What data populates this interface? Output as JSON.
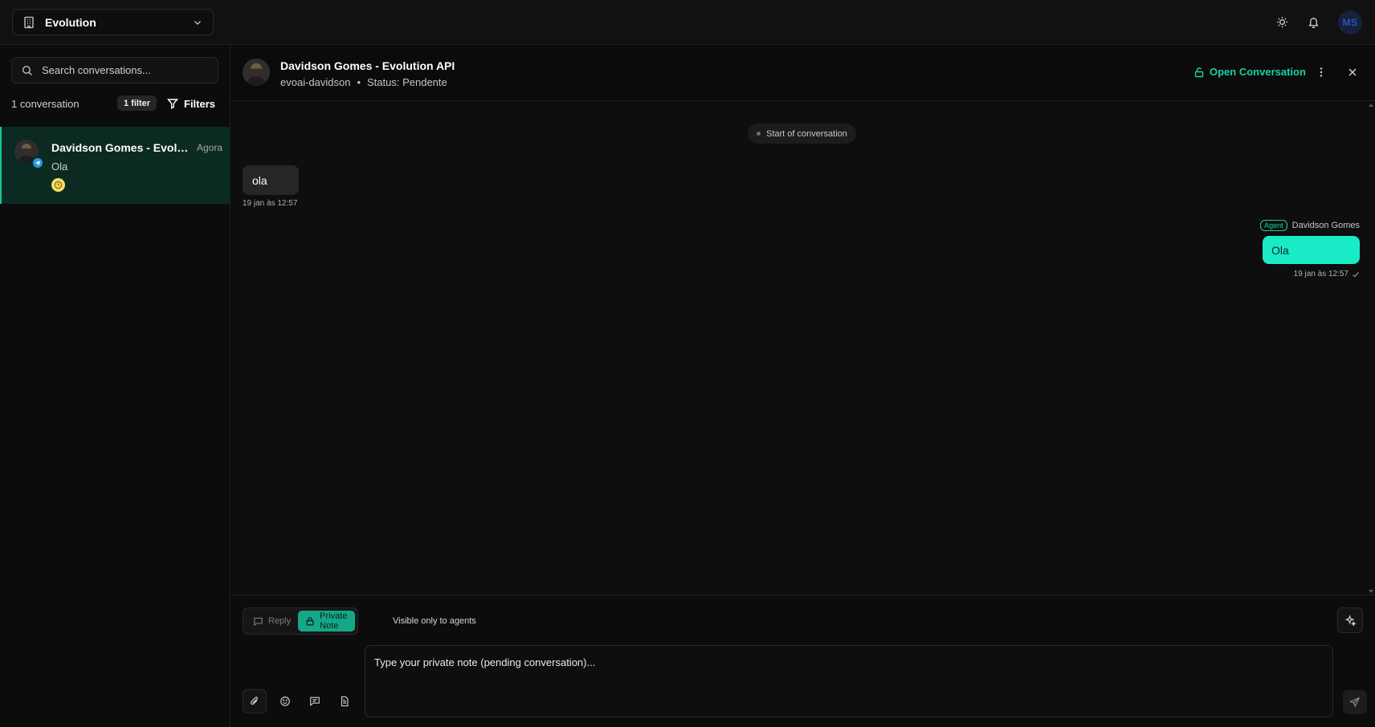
{
  "topbar": {
    "org_name": "Evolution",
    "user_initials": "MS",
    "icons": [
      "building-icon",
      "chevron-down-icon",
      "sun-icon",
      "bell-icon"
    ]
  },
  "sidebar": {
    "search_placeholder": "Search conversations...",
    "conversation_count": "1 conversation",
    "filter_badge": "1 filter",
    "filters_label": "Filters",
    "conversations": [
      {
        "name": "Davidson Gomes - Evolution API",
        "time": "Agora",
        "preview": "Ola",
        "channel": "telegram",
        "status_icon": "clock-icon"
      }
    ]
  },
  "chat": {
    "header": {
      "contact_name": "Davidson Gomes - Evolution API",
      "inbox": "evoai-davidson",
      "separator": "•",
      "status": "Status: Pendente",
      "open_button": "Open Conversation"
    },
    "start_label": "Start of conversation",
    "messages": [
      {
        "direction": "incoming",
        "text": "ola",
        "time": "19 jan às 12:57"
      },
      {
        "direction": "outgoing",
        "badge": "Agent",
        "sender": "Davidson Gomes",
        "text": "Ola",
        "time": "19 jan às 12:57"
      }
    ]
  },
  "composer": {
    "reply_label": "Reply",
    "note_label": "Private Note",
    "active_mode": "Private Note",
    "hint": "Visible only to agents",
    "placeholder": "Type your private note (pending conversation)..."
  },
  "colors": {
    "accent": "#19d2a3",
    "outgoing_bubble": "#19ebc6",
    "active_conversation": "#0b2a22",
    "pending_badge": "#f5dc6a",
    "telegram": "#2a9ae0"
  }
}
